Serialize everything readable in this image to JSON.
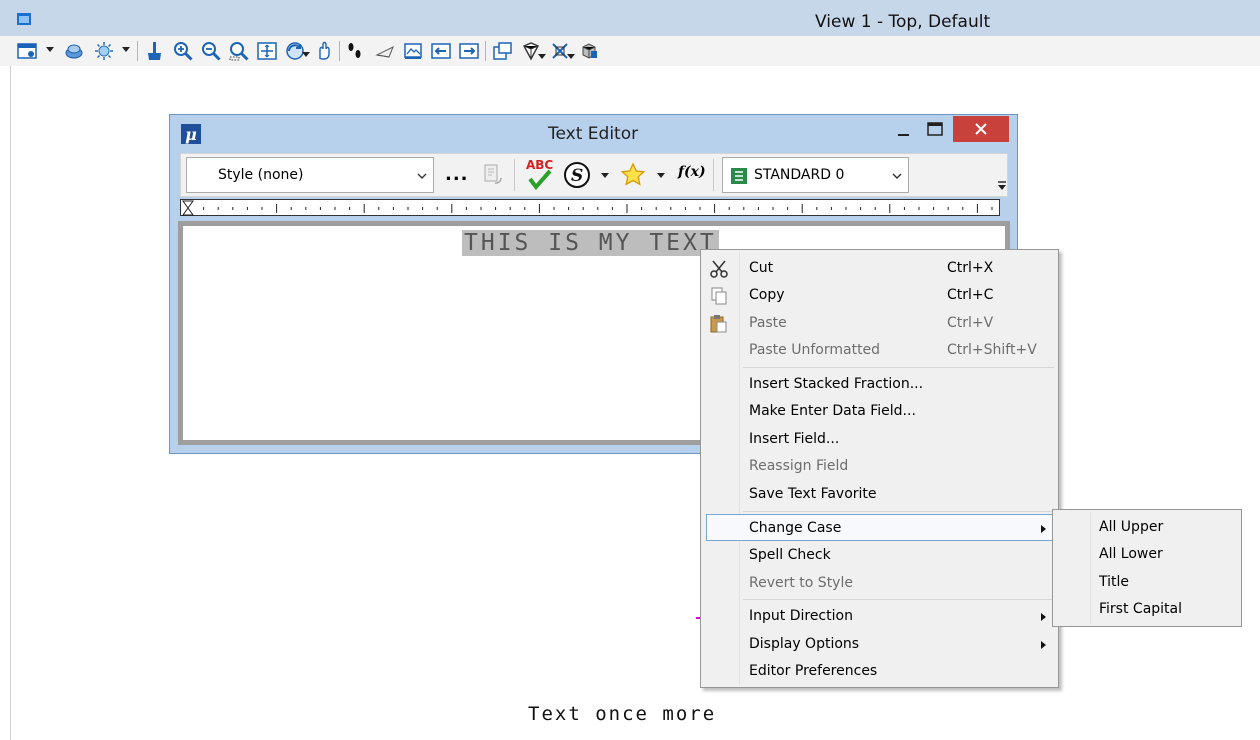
{
  "view": {
    "title": "View 1 - Top, Default",
    "toolbar_icons": [
      "view-attributes-icon",
      "levels-icon",
      "lighting-icon",
      "update-view-icon",
      "zoom-in-icon",
      "zoom-out-icon",
      "window-area-icon",
      "fit-view-icon",
      "rotate-view-icon",
      "pan-icon",
      "walk-icon",
      "camera-icon",
      "previous-view-icon",
      "next-view-icon",
      "copy-view-icon",
      "clip-volume-icon",
      "clip-mask-icon",
      "display-style-icon"
    ]
  },
  "canvas": {
    "text": "Text once more"
  },
  "editor": {
    "title": "Text Editor",
    "style_value": "Style (none)",
    "dots_label": "...",
    "fx_label": "f(x)",
    "font_value": "STANDARD 0",
    "content_text": "THIS IS MY TEXT",
    "spell_icon_text": "ABC",
    "symbol_icon_text": "S"
  },
  "context_menu": {
    "items": [
      {
        "label": "Cut",
        "shortcut": "Ctrl+X",
        "icon": "scissors-icon"
      },
      {
        "label": "Copy",
        "shortcut": "Ctrl+C",
        "icon": "copy-icon"
      },
      {
        "label": "Paste",
        "shortcut": "Ctrl+V",
        "icon": "paste-icon"
      },
      {
        "label": "Paste Unformatted",
        "shortcut": "Ctrl+Shift+V"
      },
      {
        "label": "Insert Stacked Fraction..."
      },
      {
        "label": "Make Enter Data Field..."
      },
      {
        "label": "Insert Field..."
      },
      {
        "label": "Reassign Field"
      },
      {
        "label": "Save Text Favorite"
      },
      {
        "label": "Change Case"
      },
      {
        "label": "Spell Check"
      },
      {
        "label": "Revert to Style"
      },
      {
        "label": "Input Direction"
      },
      {
        "label": "Display Options"
      },
      {
        "label": "Editor Preferences"
      }
    ]
  },
  "change_case_submenu": {
    "items": [
      "All Upper",
      "All Lower",
      "Title",
      "First Capital"
    ]
  }
}
